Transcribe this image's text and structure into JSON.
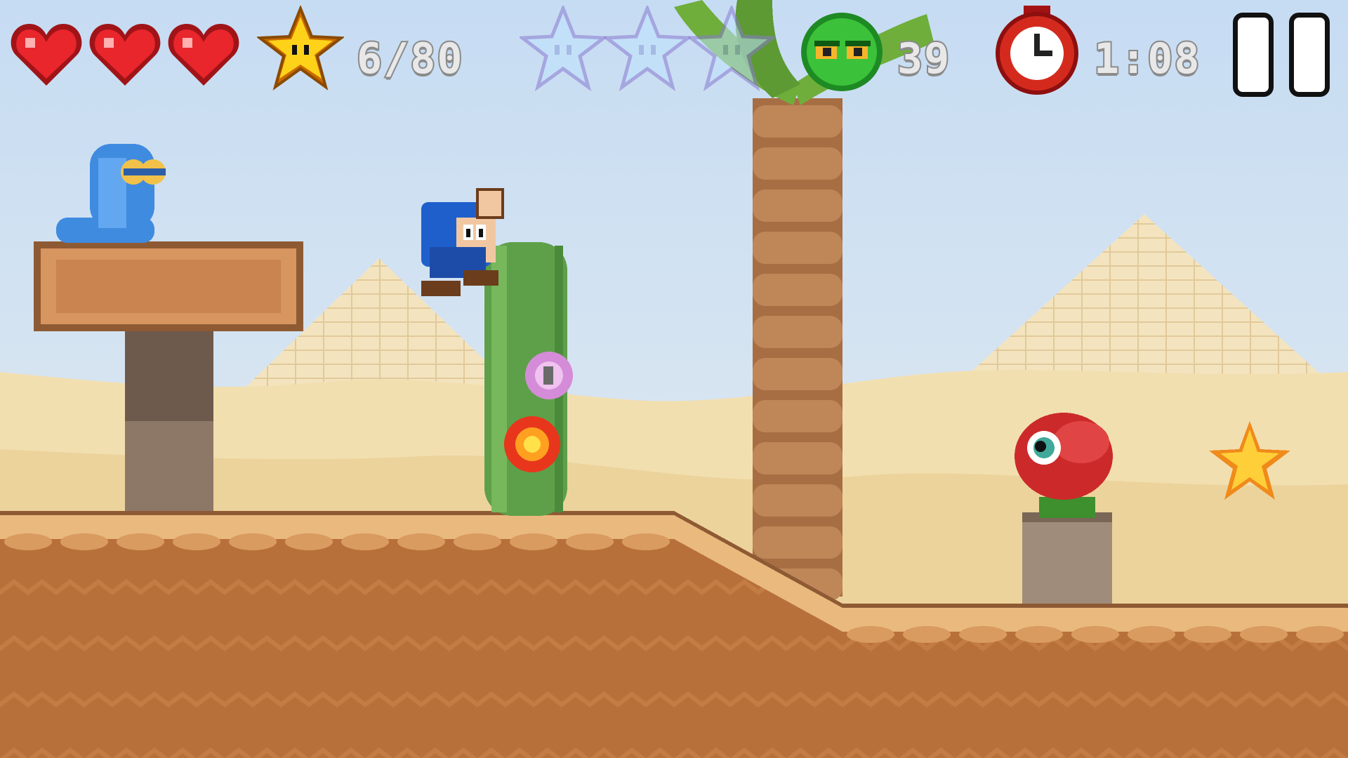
{
  "hud": {
    "lives": 3,
    "stars_collected_label": "6/80",
    "bonus_stars_total": 3,
    "bonus_stars_found": 0,
    "enemies_defeated": "39",
    "timer": "1:08"
  },
  "icons": {
    "heart": "heart-icon",
    "star": "star-icon",
    "bonus_star": "outline-star-icon",
    "enemy_counter": "green-blob-icon",
    "timer": "alarm-clock-icon",
    "pause": "pause-icon"
  },
  "colors": {
    "sky": "#cfe0f2",
    "sand": "#f1deae",
    "ground": "#b86f3a",
    "heart": "#e0262c",
    "star": "#ffb400",
    "cactus": "#5ea04a"
  }
}
